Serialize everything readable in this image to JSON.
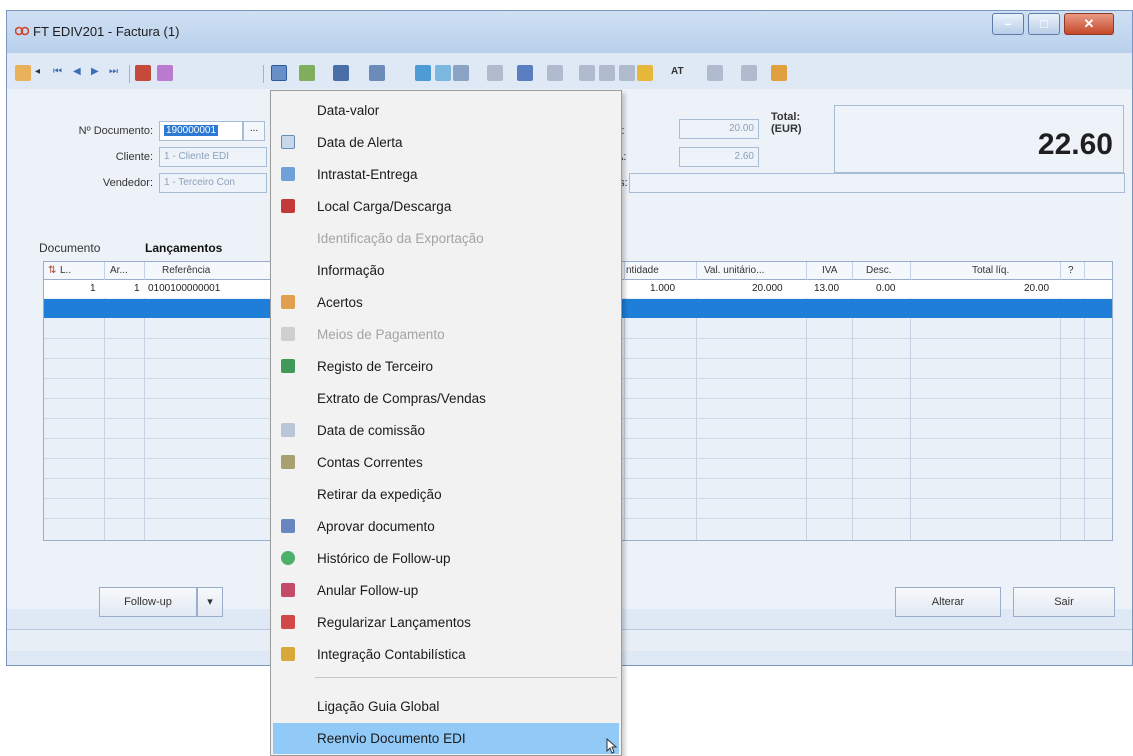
{
  "window": {
    "title": "FT EDIV201 - Factura (1)"
  },
  "toolbar": {
    "at_label": "AT"
  },
  "form": {
    "documento_label": "Nº Documento:",
    "documento_value": "190000001",
    "dots": "...",
    "cliente_label": "Cliente:",
    "cliente_value": "1 - Cliente EDI",
    "vendedor_label": "Vendedor:",
    "vendedor_value": "1 - Terceiro Con",
    "liquido_value": "20.00",
    "iva_value": "2.60",
    "total_label": "Total:",
    "total_currency": "(EUR)",
    "total_value": "22.60",
    "partial_label_1": "lo:",
    "partial_label_2": "/A:",
    "partial_label_3": "as:"
  },
  "tabs": [
    {
      "label": "Documento"
    },
    {
      "label": "Lançamentos"
    }
  ],
  "grid": {
    "headers": [
      "L..",
      "Ar...",
      "Referência",
      "ntidade",
      "Val. unitário...",
      "IVA",
      "Desc.",
      "Total líq.",
      "?"
    ],
    "row": {
      "line": "1",
      "ar": "1",
      "referencia": "0100100000001",
      "quantidade": "1.000",
      "val_unitario": "20.000",
      "iva": "13.00",
      "desc": "0.00",
      "total_liq": "20.00"
    }
  },
  "buttons": {
    "followup": "Follow-up",
    "alterar": "Alterar",
    "sair": "Sair"
  },
  "menu": {
    "items": [
      {
        "label": "Data-valor",
        "icon": "none",
        "enabled": true
      },
      {
        "label": "Data de Alerta",
        "icon": "calendar-alert-icon",
        "enabled": true
      },
      {
        "label": "Intrastat-Entrega",
        "icon": "intrastat-icon",
        "enabled": true
      },
      {
        "label": "Local Carga/Descarga",
        "icon": "truck-icon",
        "enabled": true
      },
      {
        "label": "Identificação da Exportação",
        "icon": "none",
        "enabled": false
      },
      {
        "label": "Informação",
        "icon": "none",
        "enabled": true
      },
      {
        "label": "Acertos",
        "icon": "adjust-icon",
        "enabled": true
      },
      {
        "label": "Meios de Pagamento",
        "icon": "payment-icon",
        "enabled": false
      },
      {
        "label": "Registo de Terceiro",
        "icon": "person-icon",
        "enabled": true
      },
      {
        "label": "Extrato de Compras/Vendas",
        "icon": "none",
        "enabled": true
      },
      {
        "label": "Data de comissão",
        "icon": "commission-icon",
        "enabled": true
      },
      {
        "label": "Contas Correntes",
        "icon": "accounts-icon",
        "enabled": true
      },
      {
        "label": "Retirar da expedição",
        "icon": "none",
        "enabled": true
      },
      {
        "label": "Aprovar documento",
        "icon": "approve-icon",
        "enabled": true
      },
      {
        "label": "Histórico de Follow-up",
        "icon": "history-icon",
        "enabled": true
      },
      {
        "label": "Anular Follow-up",
        "icon": "cancel-followup-icon",
        "enabled": true
      },
      {
        "label": "Regularizar Lançamentos",
        "icon": "regularize-icon",
        "enabled": true
      },
      {
        "label": "Integração Contabilística",
        "icon": "accounting-icon",
        "enabled": true
      },
      {
        "label": "Ligação Guia Global",
        "icon": "none",
        "enabled": true
      },
      {
        "label": "Reenvio Documento EDI",
        "icon": "none",
        "enabled": true,
        "highlighted": true
      }
    ]
  },
  "colors": {
    "selection_blue": "#1f7fd8",
    "menu_highlight": "#91c9f7"
  }
}
